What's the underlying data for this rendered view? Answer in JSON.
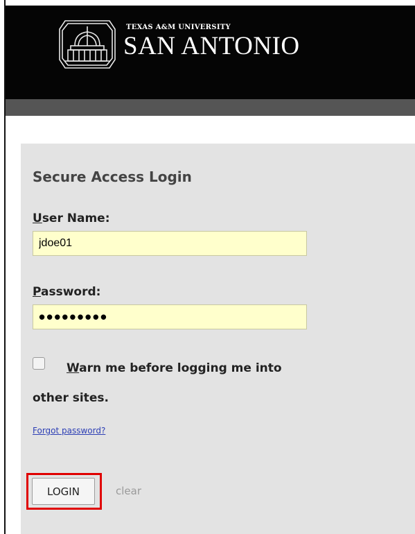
{
  "header": {
    "logo_small": "TEXAS A&M UNIVERSITY",
    "logo_big": "SAN ANTONIO"
  },
  "login": {
    "title": "Secure Access Login",
    "username_label_key": "U",
    "username_label_rest": "ser Name:",
    "username_value": "jdoe01",
    "password_label_key": "P",
    "password_label_rest": "assword:",
    "password_mask": "•••••••••",
    "warn_key": "W",
    "warn_line1_rest": "arn me before logging me into",
    "warn_line2": "other sites.",
    "forgot_link": "Forgot password?",
    "login_button": "LOGIN",
    "clear_link": "clear"
  },
  "colors": {
    "header_bg": "#050505",
    "panel_bg": "#e3e3e3",
    "field_bg": "#ffffcc",
    "highlight": "#e00000",
    "link": "#2d3fb5"
  },
  "icons": {
    "logo": "campus-dome-logo-icon"
  }
}
